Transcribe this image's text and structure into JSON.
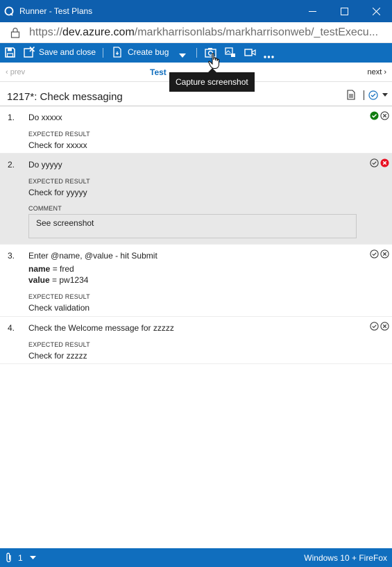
{
  "window": {
    "title": "Runner - Test Plans"
  },
  "address": {
    "scheme": "https://",
    "host": "dev.azure.com",
    "path": "/markharrisonlabs/markharrisonweb/_testExecu..."
  },
  "toolbar": {
    "save_label": "Save and close",
    "create_bug_label": "Create bug"
  },
  "tooltip": "Capture screenshot",
  "nav": {
    "prev": "prev",
    "tab": "Test",
    "next": "next"
  },
  "test_case": {
    "title": "1217*: Check messaging"
  },
  "steps": [
    {
      "num": "1.",
      "action": "Do xxxxx",
      "expected_label": "EXPECTED RESULT",
      "expected": "Check for xxxxx",
      "state": "passed"
    },
    {
      "num": "2.",
      "action": "Do yyyyy",
      "expected_label": "EXPECTED RESULT",
      "expected": "Check for yyyyy",
      "comment_label": "COMMENT",
      "comment": "See screenshot",
      "state": "failed"
    },
    {
      "num": "3.",
      "action": "Enter @name, @value - hit Submit",
      "params": [
        {
          "key": "name",
          "sep": " = ",
          "value": "fred"
        },
        {
          "key": "value",
          "sep": " = ",
          "value": "pw1234"
        }
      ],
      "expected_label": "EXPECTED RESULT",
      "expected": "Check validation",
      "state": "none"
    },
    {
      "num": "4.",
      "action": "Check the Welcome message for zzzzz",
      "expected_label": "EXPECTED RESULT",
      "expected": "Check for zzzzz",
      "state": "none"
    }
  ],
  "statusbar": {
    "attachments": "1",
    "environment": "Windows 10 + FireFox"
  },
  "colors": {
    "accent": "#106ebe",
    "titlebar": "#0e5fae",
    "pass": "#107c10",
    "fail": "#e81123"
  },
  "icons": {
    "save": "save-icon",
    "create_bug": "bug-icon",
    "capture_screenshot": "camera-icon",
    "capture_image_action": "image-action-icon",
    "record": "video-icon",
    "more": "more-icon",
    "pass": "check-circle-icon",
    "fail": "x-circle-icon"
  }
}
